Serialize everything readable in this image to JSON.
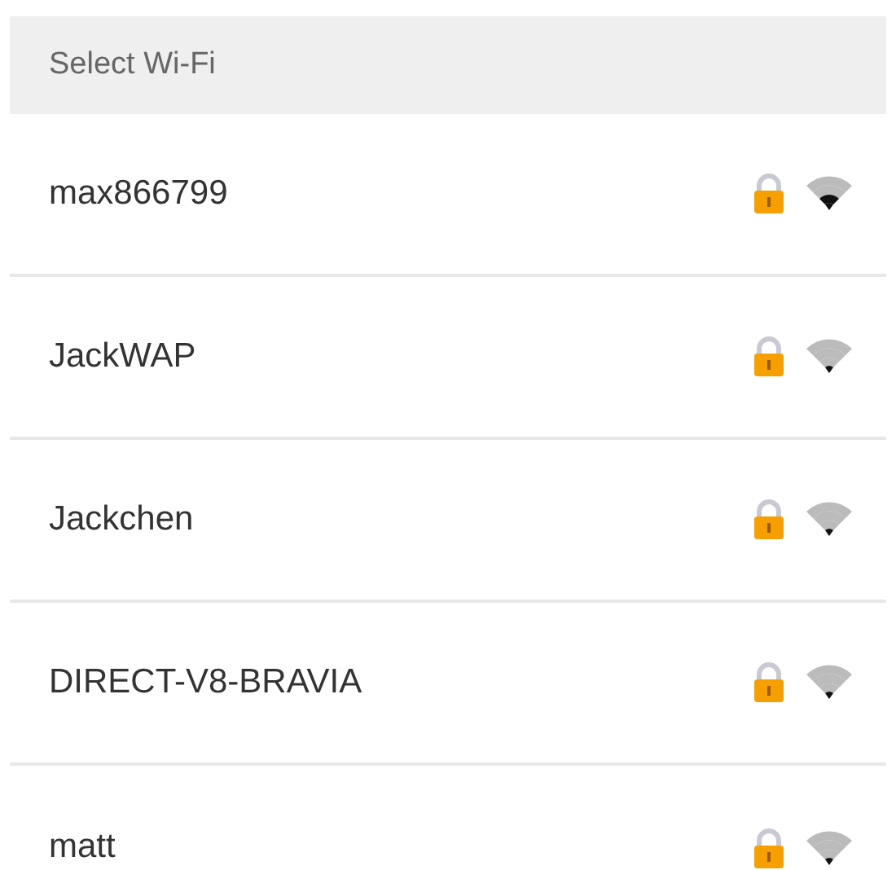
{
  "header": {
    "title": "Select Wi-Fi"
  },
  "networks": [
    {
      "name": "max866799",
      "locked": true,
      "strong_signal": true
    },
    {
      "name": "JackWAP",
      "locked": true,
      "strong_signal": false
    },
    {
      "name": "Jackchen",
      "locked": true,
      "strong_signal": false
    },
    {
      "name": "DIRECT-V8-BRAVIA",
      "locked": true,
      "strong_signal": false
    },
    {
      "name": "matt",
      "locked": true,
      "strong_signal": false
    }
  ]
}
